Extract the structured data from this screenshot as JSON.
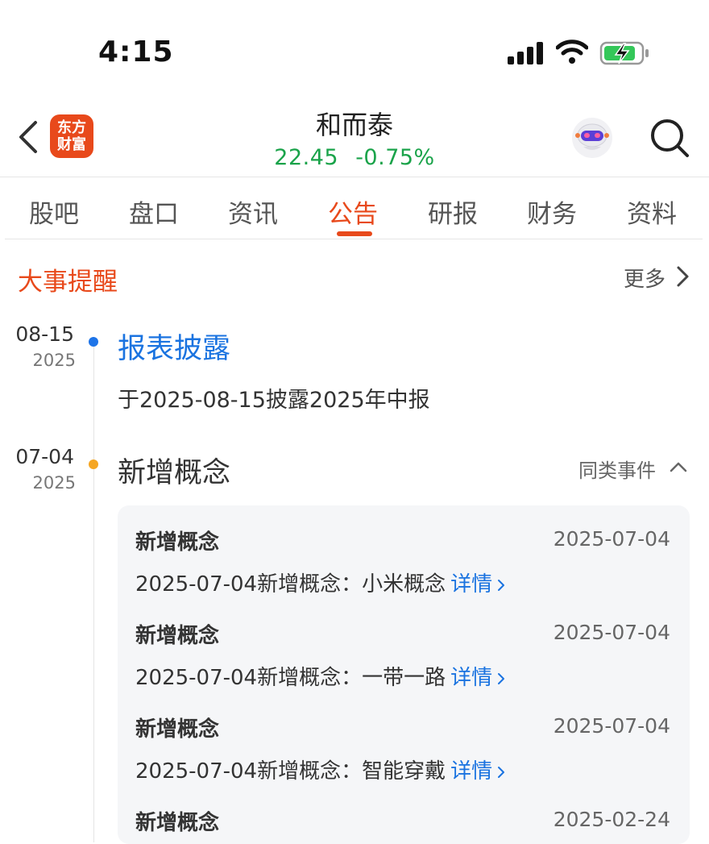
{
  "status_bar": {
    "time": "4:15"
  },
  "header": {
    "logo_line1": "东方",
    "logo_line2": "财富",
    "stock_name": "和而泰",
    "price": "22.45",
    "change_pct": "-0.75%"
  },
  "tabs": [
    {
      "label": "股吧"
    },
    {
      "label": "盘口"
    },
    {
      "label": "资讯"
    },
    {
      "label": "公告"
    },
    {
      "label": "研报"
    },
    {
      "label": "财务"
    },
    {
      "label": "资料"
    }
  ],
  "active_tab": "公告",
  "section": {
    "title": "大事提醒",
    "more_label": "更多"
  },
  "events": [
    {
      "date_md": "08-15",
      "year": "2025",
      "title": "报表披露",
      "desc": "于2025-08-15披露2025年中报"
    },
    {
      "date_md": "07-04",
      "year": "2025",
      "title": "新增概念",
      "similar_label": "同类事件",
      "items": [
        {
          "title": "新增概念",
          "date": "2025-07-04",
          "desc": "2025-07-04新增概念：小米概念",
          "link": "详情"
        },
        {
          "title": "新增概念",
          "date": "2025-07-04",
          "desc": "2025-07-04新增概念：一带一路",
          "link": "详情"
        },
        {
          "title": "新增概念",
          "date": "2025-07-04",
          "desc": "2025-07-04新增概念：智能穿戴",
          "link": "详情"
        },
        {
          "title": "新增概念",
          "date": "2025-02-24"
        }
      ]
    }
  ],
  "colors": {
    "accent": "#e8491b",
    "positive_green": "#1aa34a",
    "link_blue": "#1a73e0",
    "dot_orange": "#f5a623"
  }
}
